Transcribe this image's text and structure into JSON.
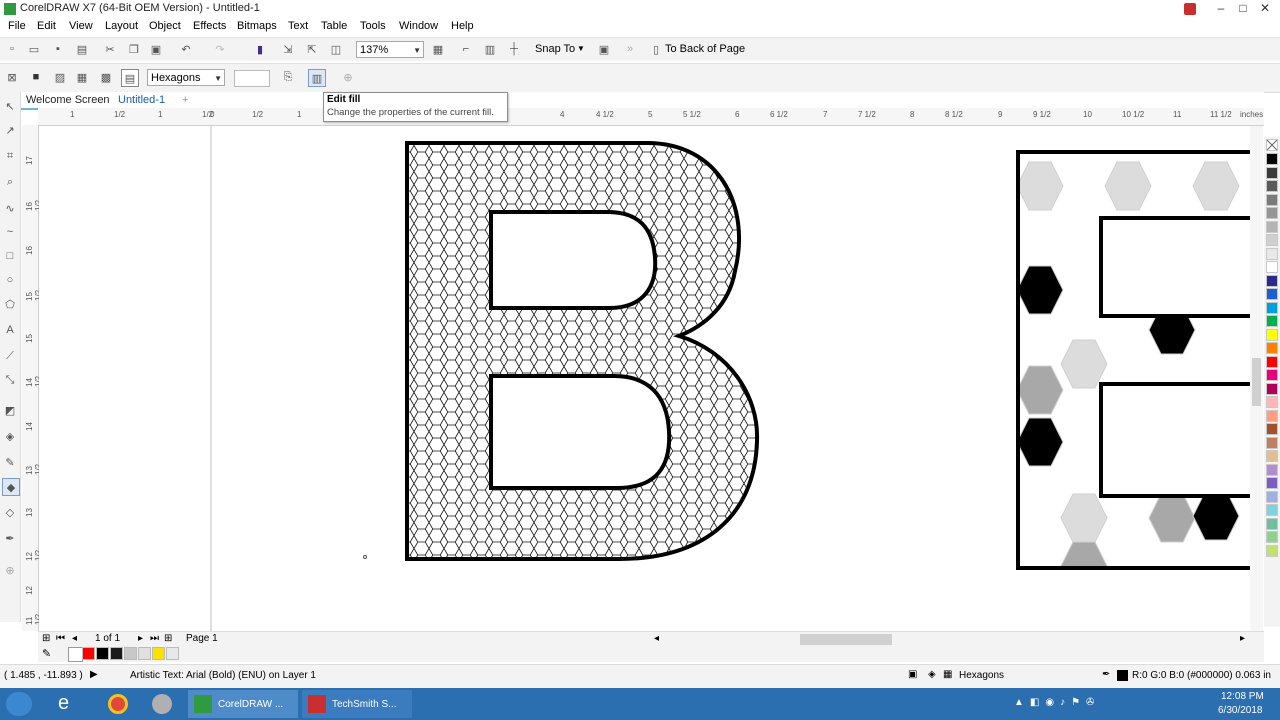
{
  "window": {
    "title": "CorelDRAW X7 (64-Bit OEM Version) - Untitled-1",
    "controls": [
      "–",
      "□",
      "✕"
    ]
  },
  "menu": [
    "File",
    "Edit",
    "View",
    "Layout",
    "Object",
    "Effects",
    "Bitmaps",
    "Text",
    "Table",
    "Tools",
    "Window",
    "Help"
  ],
  "standard_toolbar": {
    "zoom": "137%",
    "snap_to": "Snap To",
    "to_back": "To Back of Page"
  },
  "property_bar": {
    "fill_type": "Hexagons"
  },
  "tooltip": {
    "title": "Edit fill",
    "text": "Change the properties of the current fill."
  },
  "tabs": [
    "Welcome Screen",
    "Untitled-1"
  ],
  "ruler": {
    "h_labels": [
      "1",
      "1/2",
      "1",
      "1/2",
      "0",
      "1/2",
      "1",
      "4",
      "4 1/2",
      "5",
      "5 1/2",
      "6",
      "6 1/2",
      "7",
      "7 1/2",
      "8",
      "8 1/2",
      "9",
      "9 1/2",
      "10",
      "10 1/2",
      "11",
      "11 1/2",
      "inches"
    ],
    "v_labels": [
      "17",
      "16 1/2",
      "16",
      "15 1/2",
      "15",
      "14 1/2",
      "14",
      "13 1/2",
      "13",
      "12 1/2",
      "12",
      "11 1/2"
    ]
  },
  "page_nav": {
    "counter": "1 of 1",
    "page_tab": "Page 1"
  },
  "status": {
    "coords": "( 1.485 , -11.893 )",
    "object_info": "Artistic Text: Arial (Bold) (ENU) on Layer 1",
    "fill_label": "Hexagons",
    "outline_info": "R:0 G:0 B:0 (#000000)  0.063 in"
  },
  "taskbar": {
    "apps": [
      "CorelDRAW ...",
      "TechSmith S..."
    ],
    "time": "12:08 PM",
    "date": "6/30/2018"
  },
  "colors": {
    "accent": "#6cb6d6",
    "taskbar": "#2b6fb0",
    "hex_gray_light": "#dcdcdc",
    "hex_gray_mid": "#a8a8a8"
  },
  "palette_colors": [
    "#000000",
    "#3a3a3a",
    "#5a5a5a",
    "#7a7a7a",
    "#969696",
    "#b4b4b4",
    "#cfcfcf",
    "#e8e8e8",
    "#ffffff",
    "#2a2a8c",
    "#1e5fd0",
    "#00a0e0",
    "#00b050",
    "#ffff00",
    "#ff8000",
    "#ff0000",
    "#e6007e",
    "#b0005a",
    "#ffb6b6",
    "#ff9f80",
    "#a0522d",
    "#c08060",
    "#e0c090",
    "#b08fd0",
    "#7a5fc0",
    "#9fb0e0",
    "#7fd0e0",
    "#6fc0a0",
    "#90d090",
    "#c0e070"
  ],
  "doc_palette": [
    "#ff0000",
    "#000000",
    "#1a1a1a",
    "#c8c8c8",
    "#e0e0e0",
    "#ffe000",
    "#e8e8e8"
  ]
}
